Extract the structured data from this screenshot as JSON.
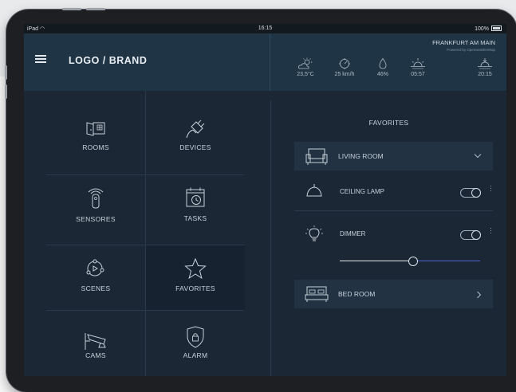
{
  "status_bar": {
    "device": "iPad",
    "time": "16:15",
    "battery": "100%"
  },
  "header": {
    "brand": "LOGO / BRAND",
    "city": "FRANKFURT AM MAIN",
    "powered_by": "Powered by OpenweatherMap",
    "weather": [
      {
        "icon": "partly-cloudy-icon",
        "value": "23,5°C"
      },
      {
        "icon": "wind-compass-icon",
        "value": "25 km/h"
      },
      {
        "icon": "humidity-drop-icon",
        "value": "46%"
      },
      {
        "icon": "sunrise-icon",
        "value": "05:57"
      },
      {
        "icon": "sunset-icon",
        "value": "20:15"
      }
    ]
  },
  "menu": {
    "tiles": [
      {
        "label": "ROOMS",
        "icon": "rooms-icon"
      },
      {
        "label": "DEVICES",
        "icon": "devices-plug-icon"
      },
      {
        "label": "SENSORES",
        "icon": "sensor-remote-icon"
      },
      {
        "label": "TASKS",
        "icon": "calendar-clock-icon"
      },
      {
        "label": "SCENES",
        "icon": "scenes-play-icon"
      },
      {
        "label": "FAVORITES",
        "icon": "star-icon",
        "active": true
      },
      {
        "label": "CAMS",
        "icon": "security-camera-icon"
      },
      {
        "label": "ALARM",
        "icon": "shield-lock-icon"
      }
    ]
  },
  "favorites": {
    "title": "FAVORITES",
    "rooms": [
      {
        "label": "LIVING ROOM",
        "icon": "armchair-icon",
        "state": "expanded"
      },
      {
        "label": "BED ROOM",
        "icon": "bed-icon",
        "state": "collapsed"
      }
    ],
    "devices": [
      {
        "label": "CEILING LAMP",
        "icon": "ceiling-lamp-icon",
        "on": true
      },
      {
        "label": "DIMMER",
        "icon": "bulb-icon",
        "on": true,
        "level": 0.52
      }
    ]
  },
  "colors": {
    "header_bg": "#1f3445",
    "body_bg": "#1b2734",
    "active_tile": "#172230",
    "slider_active": "#e4e9ee",
    "slider_inactive": "#4f63c9"
  }
}
